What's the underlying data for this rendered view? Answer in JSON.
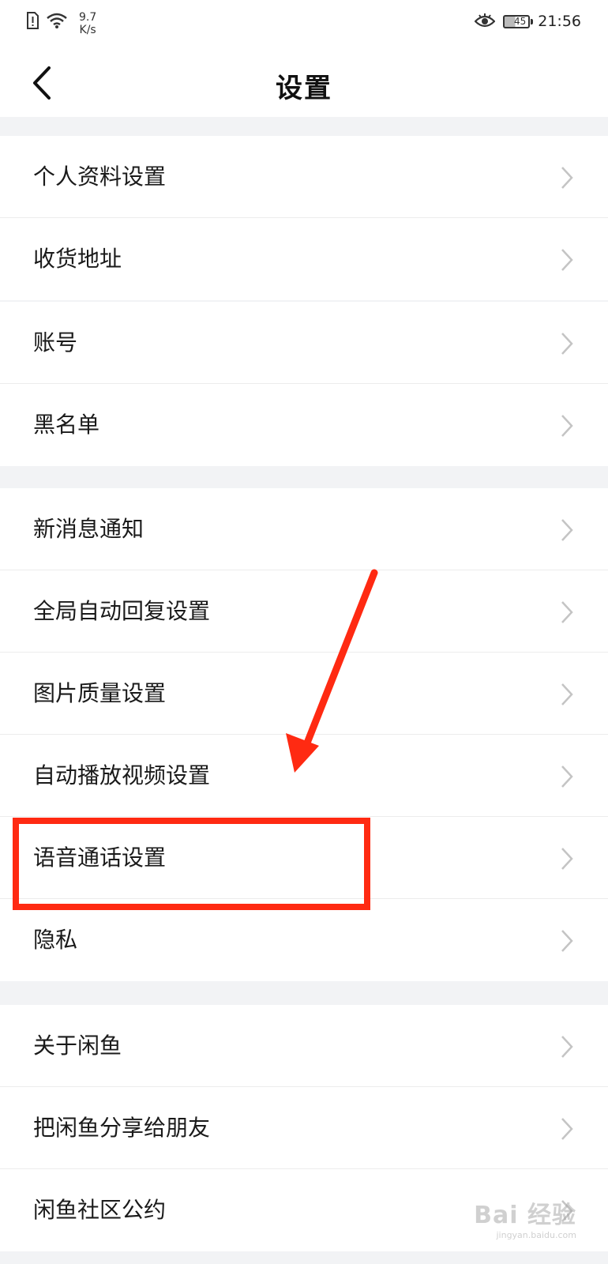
{
  "status_bar": {
    "net_speed_value": "9.7",
    "net_speed_unit": "K/s",
    "battery": "45",
    "time": "21:56"
  },
  "header": {
    "title": "设置"
  },
  "groups": [
    {
      "items": [
        {
          "label": "个人资料设置"
        },
        {
          "label": "收货地址"
        }
      ]
    },
    {
      "items": [
        {
          "label": "账号"
        },
        {
          "label": "黑名单"
        }
      ]
    },
    {
      "items": [
        {
          "label": "新消息通知"
        },
        {
          "label": "全局自动回复设置"
        },
        {
          "label": "图片质量设置"
        },
        {
          "label": "自动播放视频设置"
        },
        {
          "label": "语音通话设置"
        },
        {
          "label": "隐私"
        }
      ]
    },
    {
      "items": [
        {
          "label": "关于闲鱼"
        },
        {
          "label": "把闲鱼分享给朋友"
        },
        {
          "label": "闲鱼社区公约"
        }
      ]
    }
  ],
  "watermark": {
    "text": "Bai 经验",
    "sub": "jingyan.baidu.com"
  },
  "colors": {
    "annotation": "#ff2a12",
    "background": "#f2f3f5"
  },
  "icons": [
    "sim-alert-icon",
    "wifi-icon",
    "eye-icon",
    "battery-icon",
    "back-arrow-icon",
    "chevron-right-icon"
  ]
}
